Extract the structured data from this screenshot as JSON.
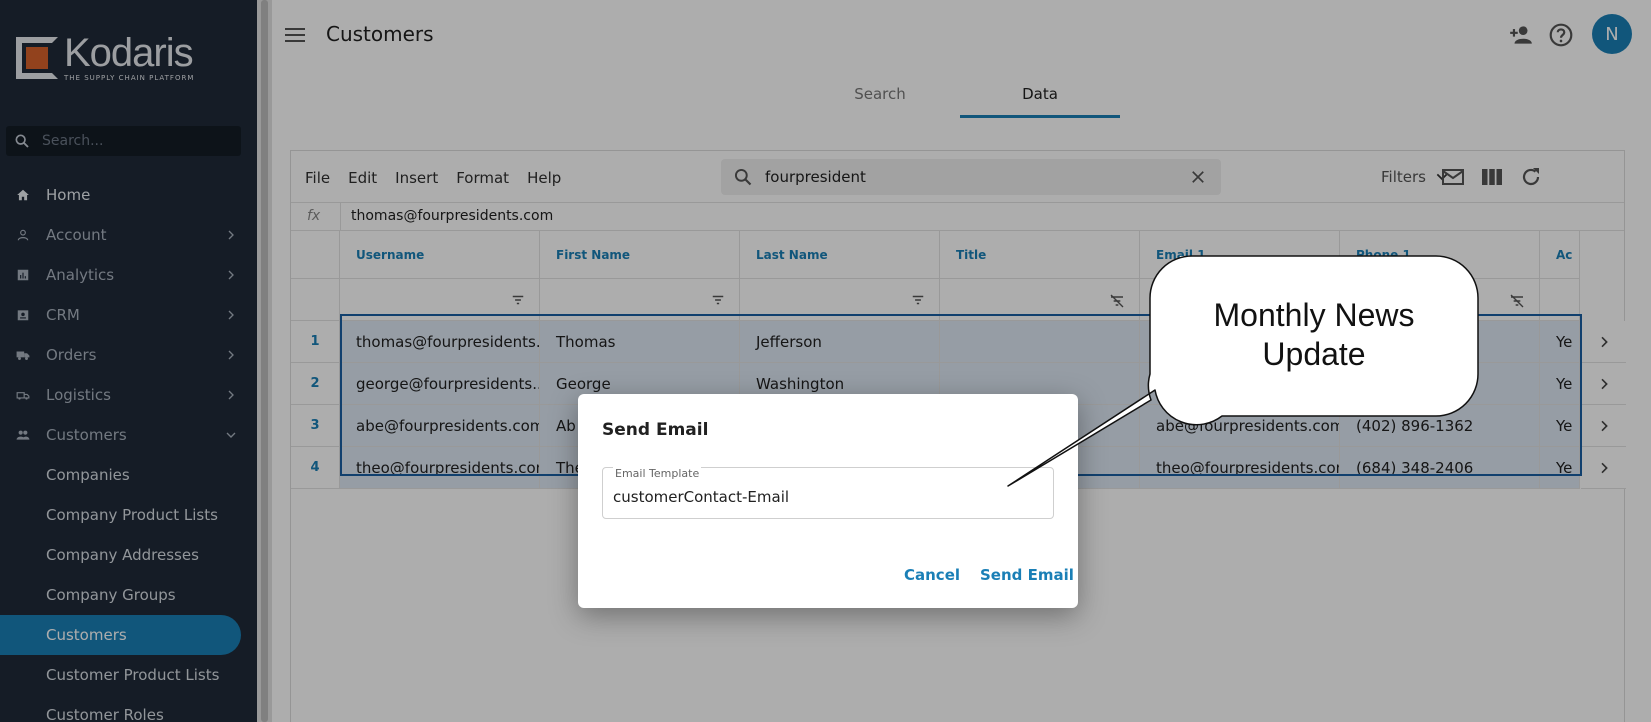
{
  "app": {
    "logo_text": "Kodaris",
    "logo_tagline": "THE SUPPLY CHAIN PLATFORM",
    "page_title": "Customers",
    "avatar_initial": "N",
    "brand_color": "#1a7fb6"
  },
  "sidebar": {
    "search_placeholder": "Search...",
    "items": [
      {
        "label": "Home",
        "icon": "home-icon"
      },
      {
        "label": "Account",
        "icon": "person-icon"
      },
      {
        "label": "Analytics",
        "icon": "analytics-icon"
      },
      {
        "label": "CRM",
        "icon": "badge-icon"
      },
      {
        "label": "Orders",
        "icon": "truck-icon"
      },
      {
        "label": "Logistics",
        "icon": "logistics-icon"
      },
      {
        "label": "Customers",
        "icon": "people-icon"
      }
    ],
    "sub_items": [
      {
        "label": "Companies"
      },
      {
        "label": "Company Product Lists"
      },
      {
        "label": "Company Addresses"
      },
      {
        "label": "Company Groups"
      },
      {
        "label": "Customers"
      },
      {
        "label": "Customer Product Lists"
      },
      {
        "label": "Customer Roles"
      }
    ]
  },
  "tabs": [
    {
      "label": "Search"
    },
    {
      "label": "Data"
    }
  ],
  "toolbar": {
    "menus": [
      "File",
      "Edit",
      "Insert",
      "Format",
      "Help"
    ],
    "search_value": "fourpresident",
    "filters_label": "Filters"
  },
  "formula_bar": {
    "fx": "fx",
    "value": "thomas@fourpresidents.com"
  },
  "table": {
    "columns": [
      "Username",
      "First Name",
      "Last Name",
      "Title",
      "Email 1",
      "Phone 1",
      "Ac"
    ],
    "rows": [
      {
        "num": "1",
        "cells": [
          "thomas@fourpresidents....",
          "Thomas",
          "Jefferson",
          "",
          "",
          "",
          "Ye"
        ]
      },
      {
        "num": "2",
        "cells": [
          "george@fourpresidents....",
          "George",
          "Washington",
          "",
          "",
          "",
          "Ye"
        ]
      },
      {
        "num": "3",
        "cells": [
          "abe@fourpresidents.com",
          "Ab",
          "",
          "",
          "abe@fourpresidents.com",
          "(402) 896-1362",
          "Ye"
        ]
      },
      {
        "num": "4",
        "cells": [
          "theo@fourpresidents.com",
          "The",
          "",
          "",
          "theo@fourpresidents.com",
          "(684) 348-2406",
          "Ye"
        ]
      }
    ]
  },
  "dialog": {
    "title": "Send Email",
    "field_label": "Email Template",
    "field_value": "customerContact-Email",
    "cancel_label": "Cancel",
    "send_label": "Send Email"
  },
  "callout": {
    "line1": "Monthly News",
    "line2": "Update"
  }
}
